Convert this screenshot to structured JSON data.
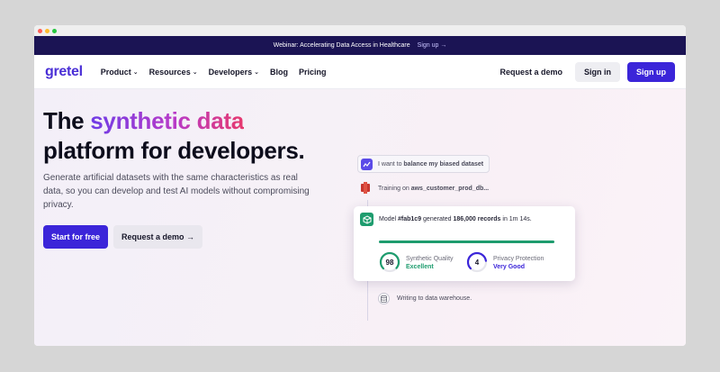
{
  "banner": {
    "text": "Webinar: Accelerating Data Access in Healthcare",
    "link": "Sign up",
    "arrow": "→"
  },
  "nav": {
    "logo": "gretel",
    "items": [
      {
        "label": "Product",
        "has_dropdown": true
      },
      {
        "label": "Resources",
        "has_dropdown": true
      },
      {
        "label": "Developers",
        "has_dropdown": true
      },
      {
        "label": "Blog",
        "has_dropdown": false
      },
      {
        "label": "Pricing",
        "has_dropdown": false
      }
    ],
    "request_demo": "Request a demo",
    "sign_in": "Sign in",
    "sign_up": "Sign up"
  },
  "hero": {
    "title_part1": "The ",
    "title_highlight": "synthetic data",
    "title_part2": "platform for developers.",
    "subtitle": "Generate artificial datasets with the same characteristics as real data, so you can develop and test AI models without compromising privacy.",
    "cta_primary": "Start for free",
    "cta_secondary": "Request a demo →"
  },
  "flow": {
    "step1_prefix": "I want to ",
    "step1_bold": "balance my biased dataset",
    "step2_prefix": "Training on ",
    "step2_bold": "aws_customer_prod_db...",
    "card": {
      "model_prefix": "Model ",
      "model_id": "#fab1c9",
      "generated_text": " generated ",
      "records": "186,000 records",
      "time_text": " in 1m 14s.",
      "progress": 1.0,
      "quality": {
        "score": "98",
        "label": "Synthetic Quality",
        "rating": "Excellent",
        "fraction": 0.98
      },
      "privacy": {
        "score": "4",
        "label": "Privacy Protection",
        "rating": "Very Good",
        "fraction": 0.8
      }
    },
    "step4": "Writing to data warehouse."
  },
  "colors": {
    "brand": "#3b25d9",
    "banner_bg": "#1b1454",
    "success": "#1e9c6e"
  },
  "icons": [
    "chevron-down-icon",
    "arrow-right-icon",
    "chart-icon",
    "aws-icon",
    "cube-icon",
    "database-icon"
  ]
}
